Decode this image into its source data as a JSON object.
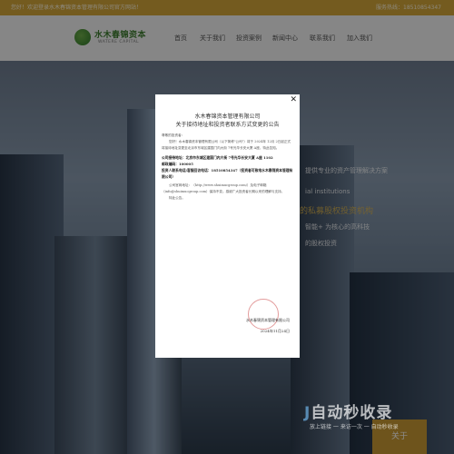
{
  "topbar": {
    "left_text": "您好！欢迎登录水木春锦资本管理有限公司官方网站！",
    "right_text": "服务热线：18510854347"
  },
  "logo": {
    "text": "水木春锦资本",
    "sub": "WATERE CAPITAL"
  },
  "nav": [
    "首页",
    "关于我们",
    "投资案例",
    "新闻中心",
    "联系我们",
    "加入我们"
  ],
  "hero": {
    "line1": "提供专业的资产管理解决方案",
    "line2": "ial institutions",
    "line3": "的私募股权投资机构",
    "line4": "智能+  为核心的高科技",
    "line5": "的股权投资",
    "cta": "关于"
  },
  "notice": {
    "company": "水木春锦资本管理有限公司",
    "title": "关于接待地址和投资者联系方式变更的公告",
    "salutation": "尊敬的投资者：",
    "para1": "您好！水木春锦资本管理有限公司（以下简称\"公司\"）将于 2024年 12月 2日起正式将接待地址变更至北京市东城区建国门内大街 7号光华长安大厦 A座，特此告知。",
    "addr_label": "公司接待地址：",
    "addr_value": "北京市东城区建国门内大街 7号光华长安大厦 A座 1102",
    "zip_label": "邮政编码：",
    "zip_value": "100005",
    "phone_label": "投资人联系电话/客服回访电话：",
    "phone_value": "18510854347（投资者可致电水木春锦资本管理有限公司）",
    "para2": "公司官网地址：（http://www.shuimucgroup.com/）及电子邮箱（info@shuimucgroup.com）保持不变。感谢广大投资者长期以来的理解与支持。",
    "closing": "特此公告。",
    "sign_company": "水木春锦资本管理有限公司",
    "sign_date": "2024年11月24日"
  },
  "watermark": {
    "brand": "自动秒收录",
    "sub": "放上链接 一 来访一次 一 自动秒收录"
  }
}
